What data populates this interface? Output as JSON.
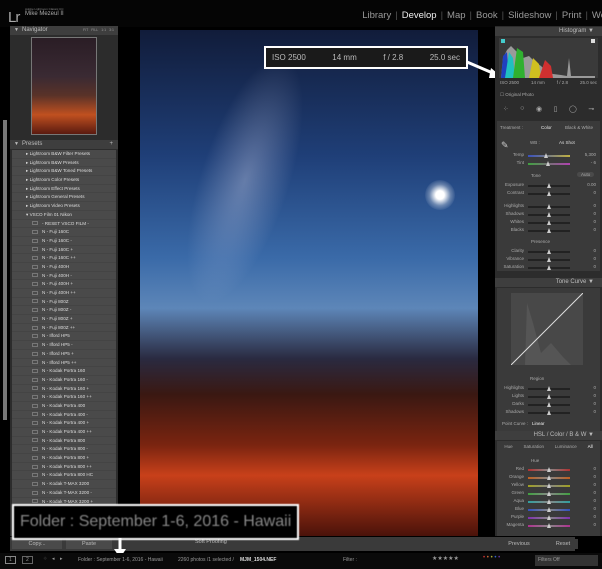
{
  "app": {
    "logo": "Lr",
    "product": "Adobe Lightroom Classic CC",
    "user": "Mike Mezeul II"
  },
  "modules": [
    {
      "label": "Library"
    },
    {
      "label": "Develop",
      "active": true
    },
    {
      "label": "Map"
    },
    {
      "label": "Book"
    },
    {
      "label": "Slideshow"
    },
    {
      "label": "Print"
    },
    {
      "label": "We"
    }
  ],
  "navigator": {
    "title": "Navigator",
    "zoom_options": [
      "FIT",
      "FILL",
      "1:1",
      "3:1"
    ]
  },
  "presets": {
    "title": "Presets",
    "add": "+",
    "groups": [
      "Lightroom B&W Filter Presets",
      "Lightroom B&W Presets",
      "Lightroom B&W Toned Presets",
      "Lightroom Color Presets",
      "Lightroom Effect Presets",
      "Lightroom General Presets",
      "Lightroom Video Presets"
    ],
    "open_group": "VSCO Film 01 Nikon",
    "items": [
      "- RESET VSCO FILM -",
      "N - Fuji 160C",
      "N - Fuji 160C -",
      "N - Fuji 160C +",
      "N - Fuji 160C ++",
      "N - Fuji 400H",
      "N - Fuji 400H -",
      "N - Fuji 400H +",
      "N - Fuji 400H ++",
      "N - Fuji 800Z",
      "N - Fuji 800Z -",
      "N - Fuji 800Z +",
      "N - Fuji 800Z ++",
      "N - Ilford HP5",
      "N - Ilford HP5 -",
      "N - Ilford HP5 +",
      "N - Ilford HP5 ++",
      "N - Kodak Portra 160",
      "N - Kodak Portra 160 -",
      "N - Kodak Portra 160 +",
      "N - Kodak Portra 160 ++",
      "N - Kodak Portra 400",
      "N - Kodak Portra 400 -",
      "N - Kodak Portra 400 +",
      "N - Kodak Portra 400 ++",
      "N - Kodak Portra 800",
      "N - Kodak Portra 800 -",
      "N - Kodak Portra 800 +",
      "N - Kodak Portra 800 ++",
      "N - Kodak Portra 800 HC",
      "N - Kodak T-MAX 3200",
      "N - Kodak T-MAX 3200 -",
      "N - Kodak T-MAX 3200 +"
    ]
  },
  "exif": {
    "iso": "ISO 2500",
    "focal": "14 mm",
    "aperture": "f / 2.8",
    "shutter": "25.0 sec"
  },
  "folder_callout": "Folder : September 1-6, 2016 - Hawaii",
  "toolbar": {
    "copy": "Copy...",
    "paste": "Paste",
    "soft_proofing": "Soft Proofing",
    "previous": "Previous",
    "reset": "Reset"
  },
  "histogram": {
    "title": "Histogram",
    "original_photo": "Original Photo"
  },
  "basic": {
    "treatment_label": "Treatment :",
    "color": "Color",
    "bw": "Black & White",
    "wb_label": "WB :",
    "wb_value": "As Shot",
    "tone_label": "Tone",
    "auto": "Auto",
    "presence_label": "Presence",
    "wb_sliders": [
      {
        "name": "Temp",
        "value": "5,300",
        "pos": 0.45
      },
      {
        "name": "Tint",
        "value": "- 6",
        "pos": 0.48
      }
    ],
    "tone_sliders": [
      {
        "name": "Exposure",
        "value": "0.00",
        "pos": 0.5
      },
      {
        "name": "Contrast",
        "value": "0",
        "pos": 0.5
      }
    ],
    "tone2_sliders": [
      {
        "name": "Highlights",
        "value": "0",
        "pos": 0.5
      },
      {
        "name": "Shadows",
        "value": "0",
        "pos": 0.5
      },
      {
        "name": "Whites",
        "value": "0",
        "pos": 0.5
      },
      {
        "name": "Blacks",
        "value": "0",
        "pos": 0.5
      }
    ],
    "presence_sliders": [
      {
        "name": "Clarity",
        "value": "0",
        "pos": 0.5
      },
      {
        "name": "Vibrance",
        "value": "0",
        "pos": 0.5
      },
      {
        "name": "Saturation",
        "value": "0",
        "pos": 0.5
      }
    ]
  },
  "tone_curve": {
    "title": "Tone Curve",
    "region": "Region",
    "point_curve_label": "Point Curve :",
    "point_curve_value": "Linear",
    "sliders": [
      {
        "name": "Highlights",
        "value": "0",
        "pos": 0.5
      },
      {
        "name": "Lights",
        "value": "0",
        "pos": 0.5
      },
      {
        "name": "Darks",
        "value": "0",
        "pos": 0.5
      },
      {
        "name": "Shadows",
        "value": "0",
        "pos": 0.5
      }
    ]
  },
  "hsl": {
    "title": "HSL  /  Color  /  B & W",
    "tabs": [
      "Hue",
      "Saturation",
      "Luminance",
      "All"
    ],
    "section": "Hue",
    "sliders": [
      {
        "name": "Red",
        "value": "0",
        "pos": 0.5,
        "color": "#b03030"
      },
      {
        "name": "Orange",
        "value": "0",
        "pos": 0.5,
        "color": "#c06020"
      },
      {
        "name": "Yellow",
        "value": "0",
        "pos": 0.5,
        "color": "#a0a020"
      },
      {
        "name": "Green",
        "value": "0",
        "pos": 0.5,
        "color": "#40a040"
      },
      {
        "name": "Aqua",
        "value": "0",
        "pos": 0.5,
        "color": "#30a0a0"
      },
      {
        "name": "Blue",
        "value": "0",
        "pos": 0.5,
        "color": "#3050c0"
      },
      {
        "name": "Purple",
        "value": "0",
        "pos": 0.5,
        "color": "#8030b0"
      },
      {
        "name": "Magenta",
        "value": "0",
        "pos": 0.5,
        "color": "#b03090"
      }
    ]
  },
  "filmstrip": {
    "view1": "1",
    "view2": "2",
    "source": "Folder : September 1-6, 2016 - Hawaii",
    "count": "2260 photos /1 selected /",
    "filename": "MJM_1504.NEF",
    "filter_label": "Filter :",
    "filters_off": "Filters Off"
  }
}
